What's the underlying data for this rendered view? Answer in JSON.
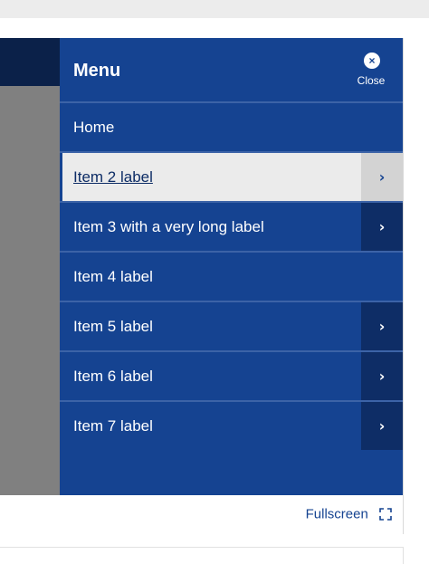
{
  "menu": {
    "title": "Menu",
    "close_label": "Close",
    "close_icon": "×",
    "items": [
      {
        "label": "Home",
        "has_submenu": false,
        "active": false
      },
      {
        "label": "Item 2 label",
        "has_submenu": true,
        "active": true
      },
      {
        "label": "Item 3 with a very long label",
        "has_submenu": true,
        "active": false
      },
      {
        "label": "Item 4 label",
        "has_submenu": false,
        "active": false
      },
      {
        "label": "Item 5 label",
        "has_submenu": true,
        "active": false
      },
      {
        "label": "Item 6 label",
        "has_submenu": true,
        "active": false
      },
      {
        "label": "Item 7 label",
        "has_submenu": true,
        "active": false
      }
    ],
    "chevron": "›"
  },
  "footer": {
    "fullscreen_label": "Fullscreen"
  },
  "colors": {
    "menu_bg": "#154391",
    "menu_dark": "#0e2d66",
    "active_bg": "#ebebeb",
    "overlay": "#808080"
  }
}
